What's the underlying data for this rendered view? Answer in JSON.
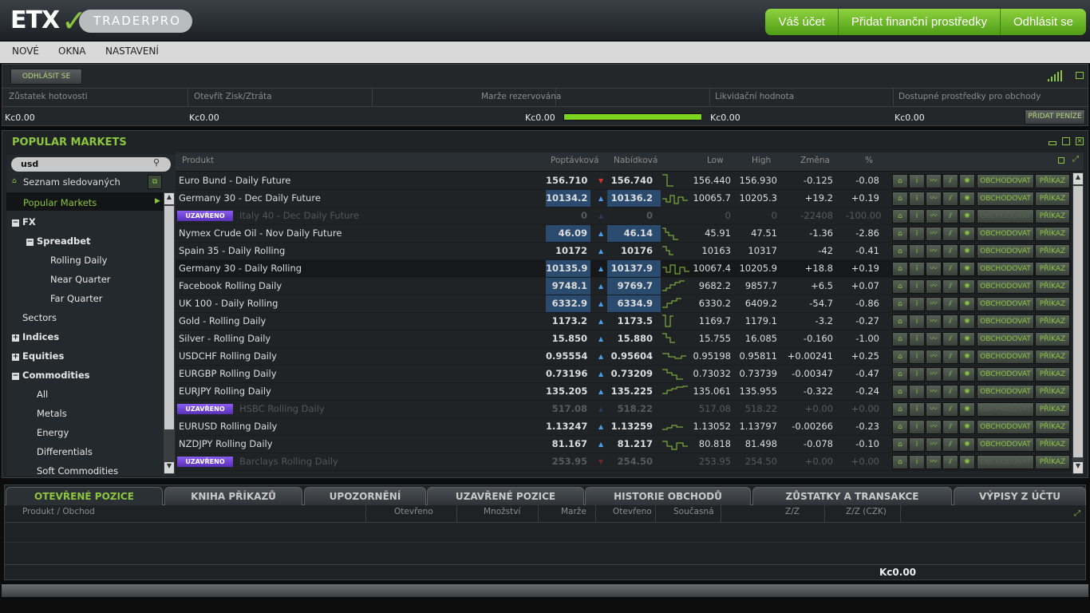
{
  "header": {
    "logo_etx": "ETX",
    "logo_traderpro": "TRADERPRO",
    "buttons": [
      "Váš účet",
      "Přidat finanční prostředky",
      "Odhlásit se"
    ]
  },
  "menu": [
    "NOVÉ",
    "OKNA",
    "NASTAVENÍ"
  ],
  "account": {
    "logout_label": "ODHLÁSIT SE",
    "labels": [
      "Zůstatek hotovosti",
      "Otevřít Zisk/Ztráta",
      "Marže rezervována",
      "Likvidační hodnota",
      "Dostupné prostředky pro obchody"
    ],
    "values": [
      "Kc0.00",
      "Kc0.00",
      "Kc0.00",
      "Kc0.00",
      "Kc0.00"
    ],
    "margin_bar_fill": 1.0,
    "add_funds_label": "PŘIDAT PENÍZE"
  },
  "markets": {
    "title": "POPULAR MARKETS",
    "search_value": "usd",
    "watchlist_label": "Seznam sledovaných",
    "tree": [
      {
        "label": "Popular Markets",
        "level": 0
      },
      {
        "label": "FX",
        "level": 0,
        "toggle": "−",
        "bold": true
      },
      {
        "label": "Spreadbet",
        "level": 1,
        "toggle": "−",
        "bold": true
      },
      {
        "label": "Rolling Daily",
        "level": 2
      },
      {
        "label": "Near Quarter",
        "level": 2
      },
      {
        "label": "Far Quarter",
        "level": 2
      },
      {
        "label": "Sectors",
        "level": 0
      },
      {
        "label": "Indices",
        "level": 0,
        "toggle": "+",
        "bold": true
      },
      {
        "label": "Equities",
        "level": 0,
        "toggle": "+",
        "bold": true
      },
      {
        "label": "Commodities",
        "level": 0,
        "toggle": "−",
        "bold": true
      },
      {
        "label": "All",
        "level": 1
      },
      {
        "label": "Metals",
        "level": 1
      },
      {
        "label": "Energy",
        "level": 1
      },
      {
        "label": "Differentials",
        "level": 1
      },
      {
        "label": "Soft Commodities",
        "level": 1
      }
    ],
    "columns": [
      "Produkt",
      "Poptávková",
      "Nabídková",
      "Low",
      "High",
      "Změna",
      "%"
    ],
    "closed_label": "UZAVŘENO",
    "trade_label": "OBCHODOVAT",
    "order_label": "PŘÍKAZ",
    "rows": [
      {
        "product": "Euro Bund - Daily Future",
        "bid": "156.710",
        "ask": "156.740",
        "dir": "down",
        "low": "156.440",
        "high": "156.930",
        "change": "-0.125",
        "pct": "-0.08",
        "closed": false,
        "hl": false
      },
      {
        "product": "Germany 30 - Dec Daily Future",
        "bid": "10134.2",
        "ask": "10136.2",
        "dir": "up",
        "low": "10065.7",
        "high": "10205.3",
        "change": "+19.2",
        "pct": "+0.19",
        "closed": false,
        "hl": true
      },
      {
        "product": "Italy 40 - Dec Daily Future",
        "bid": "0",
        "ask": "0",
        "dir": "up",
        "low": "0",
        "high": "0",
        "change": "-22408",
        "pct": "-100.00",
        "closed": true,
        "hl": false
      },
      {
        "product": "Nymex Crude Oil - Nov Daily Future",
        "bid": "46.09",
        "ask": "46.14",
        "dir": "up",
        "low": "45.91",
        "high": "47.51",
        "change": "-1.36",
        "pct": "-2.86",
        "closed": false,
        "hl": true
      },
      {
        "product": "Spain 35 - Daily Rolling",
        "bid": "10172",
        "ask": "10176",
        "dir": "up",
        "low": "10163",
        "high": "10317",
        "change": "-42",
        "pct": "-0.41",
        "closed": false,
        "hl": false
      },
      {
        "product": "Germany 30 - Daily Rolling",
        "bid": "10135.9",
        "ask": "10137.9",
        "dir": "up",
        "low": "10067.4",
        "high": "10205.9",
        "change": "+18.8",
        "pct": "+0.19",
        "closed": false,
        "hl": true
      },
      {
        "product": "Facebook Rolling Daily",
        "bid": "9748.1",
        "ask": "9769.7",
        "dir": "up",
        "low": "9682.2",
        "high": "9857.7",
        "change": "+6.5",
        "pct": "+0.07",
        "closed": false,
        "hl": true
      },
      {
        "product": "UK 100 - Daily Rolling",
        "bid": "6332.9",
        "ask": "6334.9",
        "dir": "up",
        "low": "6330.2",
        "high": "6409.2",
        "change": "-54.7",
        "pct": "-0.86",
        "closed": false,
        "hl": true
      },
      {
        "product": "Gold - Rolling Daily",
        "bid": "1173.2",
        "ask": "1173.5",
        "dir": "up",
        "low": "1169.7",
        "high": "1179.1",
        "change": "-3.2",
        "pct": "-0.27",
        "closed": false,
        "hl": false
      },
      {
        "product": "Silver - Rolling Daily",
        "bid": "15.850",
        "ask": "15.880",
        "dir": "up",
        "low": "15.755",
        "high": "16.085",
        "change": "-0.160",
        "pct": "-1.00",
        "closed": false,
        "hl": false
      },
      {
        "product": "USDCHF Rolling Daily",
        "bid": "0.95554",
        "ask": "0.95604",
        "dir": "up",
        "low": "0.95198",
        "high": "0.95811",
        "change": "+0.00241",
        "pct": "+0.25",
        "closed": false,
        "hl": false
      },
      {
        "product": "EURGBP Rolling Daily",
        "bid": "0.73196",
        "ask": "0.73209",
        "dir": "up",
        "low": "0.73032",
        "high": "0.73739",
        "change": "-0.00347",
        "pct": "-0.47",
        "closed": false,
        "hl": false
      },
      {
        "product": "EURJPY  Rolling Daily",
        "bid": "135.205",
        "ask": "135.225",
        "dir": "up",
        "low": "135.061",
        "high": "135.955",
        "change": "-0.322",
        "pct": "-0.24",
        "closed": false,
        "hl": false
      },
      {
        "product": "HSBC Rolling Daily",
        "bid": "517.08",
        "ask": "518.22",
        "dir": "up",
        "low": "517.08",
        "high": "518.22",
        "change": "+0.00",
        "pct": "+0.00",
        "closed": true,
        "hl": false
      },
      {
        "product": "EURUSD Rolling Daily",
        "bid": "1.13247",
        "ask": "1.13259",
        "dir": "up",
        "low": "1.13052",
        "high": "1.13797",
        "change": "-0.00266",
        "pct": "-0.23",
        "closed": false,
        "hl": false
      },
      {
        "product": "NZDJPY  Rolling Daily",
        "bid": "81.167",
        "ask": "81.217",
        "dir": "up",
        "low": "80.818",
        "high": "81.498",
        "change": "-0.078",
        "pct": "-0.10",
        "closed": false,
        "hl": false
      },
      {
        "product": "Barclays Rolling Daily",
        "bid": "253.95",
        "ask": "254.50",
        "dir": "down",
        "low": "253.95",
        "high": "254.50",
        "change": "+0.00",
        "pct": "+0.00",
        "closed": true,
        "hl": false
      }
    ]
  },
  "positions": {
    "tabs": [
      "OTEVŘENÉ POZICE",
      "KNIHA PŘÍKAZŮ",
      "UPOZORNĚNÍ",
      "UZAVŘENÉ POZICE",
      "HISTORIE OBCHODŮ",
      "ZŮSTATKY A TRANSAKCE",
      "VÝPISY Z ÚČTU"
    ],
    "columns": [
      "Produkt / Obchod",
      "Otevřeno",
      "Množství",
      "Marže",
      "Otevřeno",
      "Současná",
      "Z/Z",
      "Z/Z (CZK)"
    ],
    "total": "Kc0.00"
  }
}
